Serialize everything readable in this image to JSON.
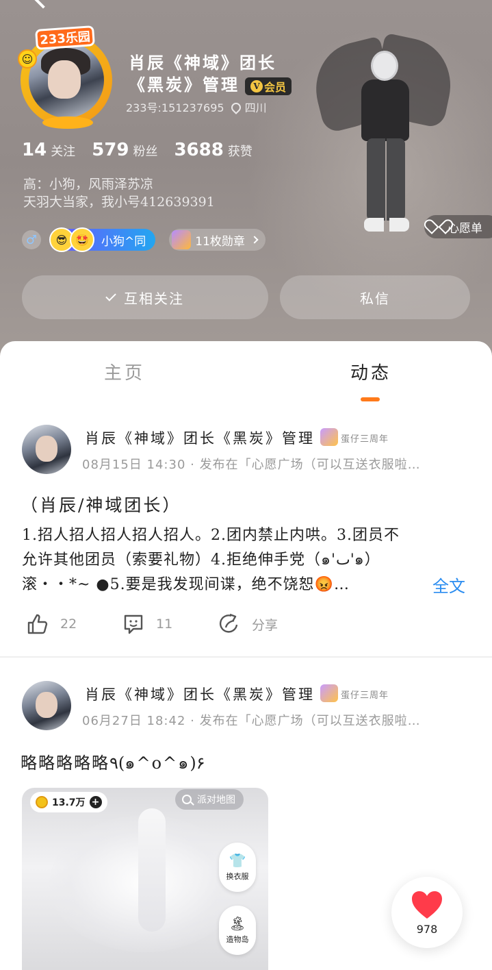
{
  "profile": {
    "brand_badge": "233乐园",
    "name_line1": "肖辰《神域》团长",
    "name_line2": "《黑炭》管理",
    "vip_label": "会员",
    "vip_letter": "V",
    "id_text": "233号:151237695",
    "location": "四川",
    "stats": [
      {
        "value": "14",
        "label": "关注"
      },
      {
        "value": "579",
        "label": "粉丝"
      },
      {
        "value": "3688",
        "label": "获赞"
      }
    ],
    "bio": "高：小狗，风雨泽苏凉\n天羽大当家，我小号412639391",
    "gender_symbol": "♂",
    "friend_name": "小狗^同",
    "medal_text": "11枚勋章",
    "wish_label": "心愿单"
  },
  "actions": {
    "follow_label": "互相关注",
    "message_label": "私信"
  },
  "tabs": [
    {
      "label": "主页",
      "active": false
    },
    {
      "label": "动态",
      "active": true
    }
  ],
  "colors": {
    "accent": "#ff7a1a",
    "link": "#2a8cf0",
    "like": "#ff3b4a"
  },
  "posts": [
    {
      "author": "肖辰《神域》团长《黑炭》管理",
      "badge_text": "蛋仔三周年",
      "meta": "08月15日 14:30 · 发布在「心愿广场（可以互送衣服啦…",
      "title": "（肖辰/神域团长）",
      "body_lines": [
        "1.招人招人招人招人招人。2.团内禁止内哄。3.团员不",
        "允许其他团员（索要礼物）4.拒绝伸手党（๑'ٮ'๑）",
        "滚・・*~ ●5.要是我发现间谍，绝不饶恕😡…"
      ],
      "read_more": "全文",
      "likes": "22",
      "comments": "11",
      "share_label": "分享"
    },
    {
      "author": "肖辰《神域》团长《黑炭》管理",
      "badge_text": "蛋仔三周年",
      "meta": "06月27日 18:42 · 发布在「心愿广场（可以互送衣服啦…",
      "title": "略略略略略٩(๑^o^๑)۶",
      "image": {
        "coins": "13.7万",
        "map_label": "派对地图",
        "wardrobe_label": "换衣服",
        "island_label": "造物岛"
      }
    }
  ],
  "floating_like": {
    "count": "978"
  }
}
